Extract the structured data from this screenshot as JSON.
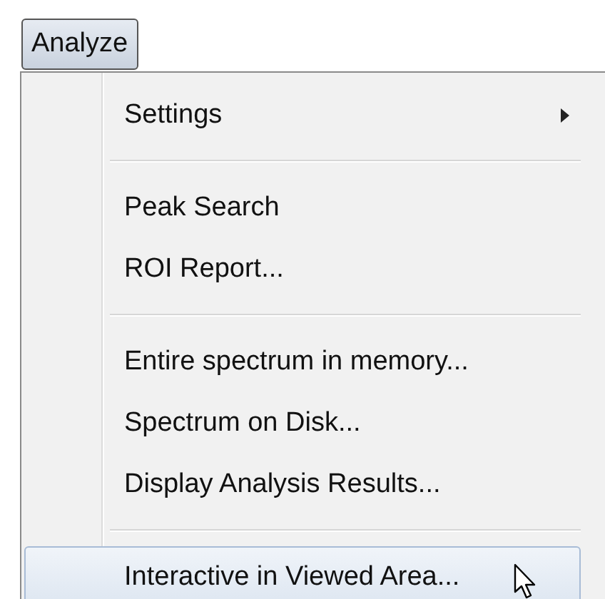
{
  "menu_button": {
    "label": "Analyze",
    "selected": true
  },
  "menu": {
    "items": [
      {
        "kind": "item",
        "label": "Settings",
        "submenu": true,
        "selected": false
      },
      {
        "kind": "separator"
      },
      {
        "kind": "item",
        "label": "Peak Search",
        "submenu": false,
        "selected": false
      },
      {
        "kind": "item",
        "label": "ROI Report...",
        "submenu": false,
        "selected": false
      },
      {
        "kind": "separator"
      },
      {
        "kind": "item",
        "label": "Entire spectrum in memory...",
        "submenu": false,
        "selected": false
      },
      {
        "kind": "item",
        "label": "Spectrum on Disk...",
        "submenu": false,
        "selected": false
      },
      {
        "kind": "item",
        "label": "Display Analysis Results...",
        "submenu": false,
        "selected": false
      },
      {
        "kind": "separator"
      },
      {
        "kind": "item",
        "label": "Interactive in Viewed Area...",
        "submenu": false,
        "selected": true
      }
    ]
  }
}
